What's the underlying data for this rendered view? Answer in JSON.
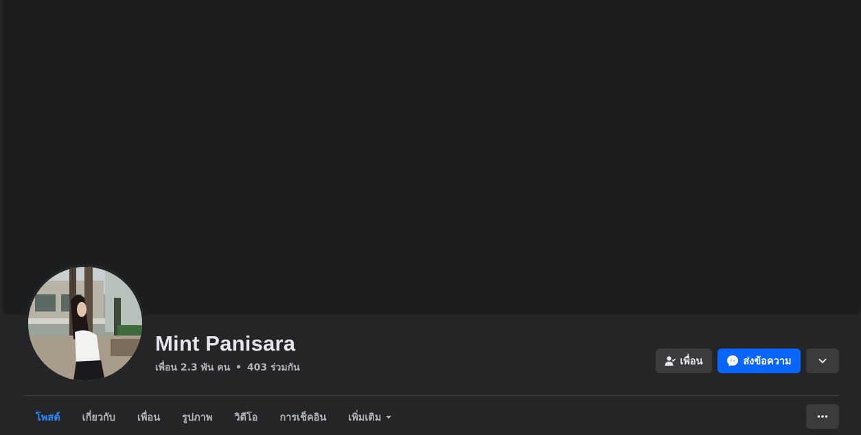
{
  "profile": {
    "name": "Mint Panisara",
    "friends_count": "เพื่อน 2.3 พัน คน",
    "separator": "•",
    "mutual": "403 ร่วมกัน"
  },
  "actions": {
    "friend_label": "เพื่อน",
    "message_label": "ส่งข้อความ"
  },
  "tabs": [
    {
      "label": "โพสต์",
      "active": true
    },
    {
      "label": "เกี่ยวกับ",
      "active": false
    },
    {
      "label": "เพื่อน",
      "active": false
    },
    {
      "label": "รูปภาพ",
      "active": false
    },
    {
      "label": "วิดีโอ",
      "active": false
    },
    {
      "label": "การเช็คอิน",
      "active": false
    },
    {
      "label": "เพิ่มเติม",
      "active": false
    }
  ],
  "colors": {
    "accent": "#0866ff",
    "active_tab": "#2d88ff",
    "background": "#242526",
    "cover": "#1c1d1f"
  },
  "icons": [
    "friend-icon",
    "messenger-icon",
    "chevron-down-icon",
    "caret-down-icon",
    "more-dots-icon"
  ]
}
